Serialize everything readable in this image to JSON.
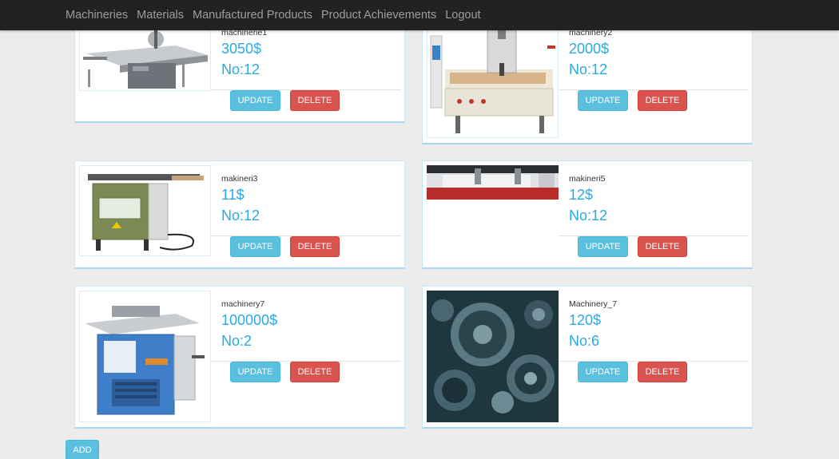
{
  "nav": {
    "links": [
      "Machineries",
      "Materials",
      "Manufactured Products",
      "Product Achievements",
      "Logout"
    ]
  },
  "buttons": {
    "update": "UPDATE",
    "delete": "DELETE",
    "add": "ADD"
  },
  "items": [
    {
      "name": "machinerie1",
      "price": "3050$",
      "count": "No:12",
      "image_icon": "table-saw-image"
    },
    {
      "name": "machinery2",
      "price": "2000$",
      "count": "No:12",
      "image_icon": "cnc-router-image"
    },
    {
      "name": "makineri3",
      "price": "11$",
      "count": "No:12",
      "image_icon": "edge-bander-image"
    },
    {
      "name": "makineri5",
      "price": "12$",
      "count": "No:12",
      "image_icon": "cnc-banner-image"
    },
    {
      "name": "machinery7",
      "price": "100000$",
      "count": "No:2",
      "image_icon": "planer-machine-image"
    },
    {
      "name": "Machinery_7",
      "price": "120$",
      "count": "No:6",
      "image_icon": "gears-image"
    }
  ],
  "colors": {
    "accent": "#29abe2",
    "update": "#5bc0de",
    "delete": "#d9534f",
    "navbar": "#222222"
  }
}
